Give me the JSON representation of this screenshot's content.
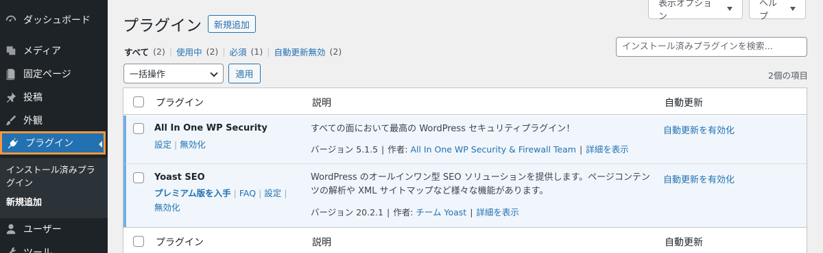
{
  "sidebar": {
    "items": [
      {
        "label": "ダッシュボード",
        "icon": "dashboard-icon"
      },
      {
        "label": "メディア",
        "icon": "media-icon"
      },
      {
        "label": "固定ページ",
        "icon": "page-icon"
      },
      {
        "label": "投稿",
        "icon": "pin-icon"
      },
      {
        "label": "外観",
        "icon": "brush-icon"
      },
      {
        "label": "プラグイン",
        "icon": "plugin-icon"
      },
      {
        "label": "ユーザー",
        "icon": "user-icon"
      },
      {
        "label": "ツール",
        "icon": "tool-icon"
      }
    ],
    "submenu": [
      "インストール済みプラ",
      "グイン",
      "新規追加"
    ]
  },
  "header": {
    "title": "プラグイン",
    "add_new": "新規追加",
    "screen_options": "表示オプション",
    "help": "ヘルプ"
  },
  "filters": {
    "all": "すべて",
    "all_count": "(2)",
    "active": "使用中",
    "active_count": "(2)",
    "mustuse": "必須",
    "mustuse_count": "(1)",
    "autoupdate_disabled": "自動更新無効",
    "autoupdate_disabled_count": "(2)"
  },
  "search": {
    "placeholder": "インストール済みプラグインを検索..."
  },
  "bulk": {
    "selected": "一括操作",
    "apply": "適用",
    "items_count": "2個の項目"
  },
  "table": {
    "columns": {
      "plugin": "プラグイン",
      "description": "説明",
      "auto_update": "自動更新"
    },
    "rows": [
      {
        "name": "All In One WP Security",
        "actions": [
          "設定",
          "無効化"
        ],
        "description": "すべての面において最高の WordPress セキュリティプラグイン！",
        "version": "バージョン 5.1.5",
        "author_label": "作者:",
        "author": "All In One WP Security & Firewall Team",
        "details": "詳細を表示",
        "auto_update": "自動更新を有効化"
      },
      {
        "name": "Yoast SEO",
        "actions": [
          "プレミアム版を入手",
          "FAQ",
          "設定",
          "無効化"
        ],
        "description_line1": "WordPress のオールインワン型 SEO ソリューションを提供します。ページコンテン",
        "description_line2": "ツの解析や XML サイトマップなど様々な機能があります。",
        "version": "バージョン 20.2.1",
        "author_label": "作者:",
        "author": "チーム Yoast",
        "details": "詳細を表示",
        "auto_update": "自動更新を有効化"
      }
    ]
  },
  "colors": {
    "sidebar_bg": "#1d2327",
    "accent": "#2271b1",
    "active_outline": "#f6983e",
    "row_highlight": "#f0f6fc"
  }
}
